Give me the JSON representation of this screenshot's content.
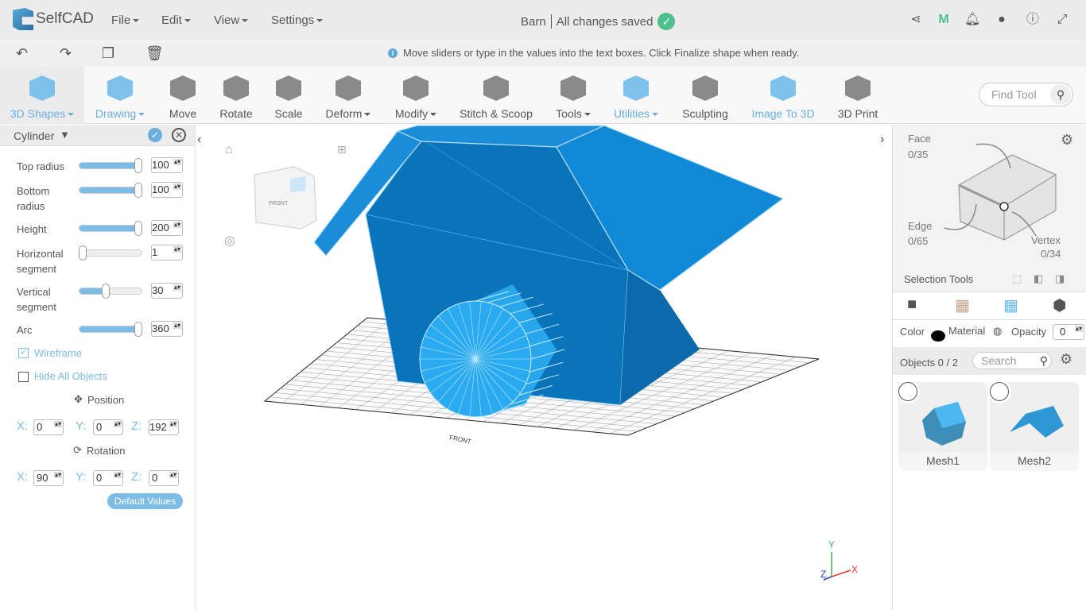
{
  "app": {
    "name": "SelfCAD",
    "doc_title": "Barn",
    "save_status": "All changes saved"
  },
  "menu": [
    "File",
    "Edit",
    "View",
    "Settings"
  ],
  "hint": "Move sliders or type in the values into the text boxes. Click Finalize shape when ready.",
  "toolbar": [
    "3D Shapes",
    "Drawing",
    "Move",
    "Rotate",
    "Scale",
    "Deform",
    "Modify",
    "Stitch & Scoop",
    "Tools",
    "Utilities",
    "Sculpting",
    "Image To 3D",
    "3D Print"
  ],
  "find_tool_placeholder": "Find Tool",
  "panel": {
    "title": "Cylinder",
    "params": [
      {
        "label": "Top radius",
        "value": "100",
        "level": 1.0
      },
      {
        "label": "Bottom radius",
        "value": "100",
        "level": 1.0
      },
      {
        "label": "Height",
        "value": "200",
        "level": 1.0
      },
      {
        "label": "Horizontal segment",
        "value": "1",
        "level": 0.0
      },
      {
        "label": "Vertical segment",
        "value": "30",
        "level": 0.42
      },
      {
        "label": "Arc",
        "value": "360",
        "level": 1.0
      }
    ],
    "wireframe": "Wireframe",
    "hide_all": "Hide All Objects",
    "position_label": "Position",
    "position": {
      "x": "0",
      "y": "0",
      "z": "192"
    },
    "rotation_label": "Rotation",
    "rotation": {
      "x": "90",
      "y": "0",
      "z": "0"
    },
    "axis": {
      "x": "X:",
      "y": "Y:",
      "z": "Z:"
    },
    "default_values": "Default Values"
  },
  "viewcube": {
    "front": "FRONT"
  },
  "grid_label": "FRONT",
  "gizmo": {
    "x": "X",
    "y": "Y",
    "z": "Z"
  },
  "right": {
    "face": "Face",
    "face_count": "0/35",
    "edge": "Edge",
    "edge_count": "0/65",
    "vertex": "Vertex",
    "vertex_count": "0/34",
    "selection_tools": "Selection Tools",
    "color": "Color",
    "material": "Material",
    "opacity": "Opacity",
    "opacity_value": "0",
    "objects": "Objects 0 / 2",
    "search_placeholder": "Search",
    "meshes": [
      "Mesh1",
      "Mesh2"
    ]
  },
  "colors": {
    "accent": "#7cbce6",
    "model_dark": "#0a74bb",
    "model_light": "#2aa8ee",
    "save_ok": "#4fc08d"
  }
}
